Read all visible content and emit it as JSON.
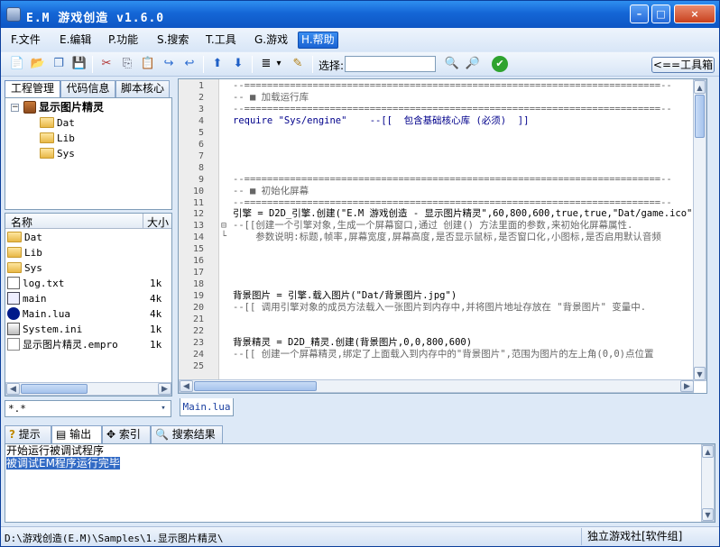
{
  "window": {
    "title": "E.M 游戏创造 v1.6.0",
    "buttons": {
      "minimize": "–",
      "maximize": "□",
      "close": "×"
    }
  },
  "menu": {
    "items": [
      {
        "label": "F.文件"
      },
      {
        "label": "E.编辑"
      },
      {
        "label": "P.功能"
      },
      {
        "label": "S.搜索"
      },
      {
        "label": "T.工具"
      },
      {
        "label": "G.游戏"
      },
      {
        "label": "H.帮助"
      }
    ]
  },
  "toolbar": {
    "icons": {
      "new": "📄",
      "open": "📂",
      "copy_window": "❐",
      "save": "💾",
      "cut": "✂",
      "copy": "⎘",
      "paste": "📋",
      "redo": "↪",
      "undo": "↩",
      "up": "⬆",
      "down": "⬇",
      "list": "≣",
      "dropdown": "▾",
      "comment": "✎",
      "find": "🔍",
      "find_next": "🔎",
      "ok": "✔"
    },
    "select_label": "选择:",
    "select_value": "",
    "toolbox_button": "<==工具箱"
  },
  "project_panel": {
    "tabs": [
      "工程管理",
      "代码信息",
      "脚本核心"
    ],
    "tree": {
      "root": "显示图片精灵",
      "expander": "−",
      "children": [
        "Dat",
        "Lib",
        "Sys"
      ]
    },
    "files": {
      "col_name": "名称",
      "col_size": "大小",
      "rows": [
        {
          "name": "Dat",
          "size": "",
          "icon": "folder"
        },
        {
          "name": "Lib",
          "size": "",
          "icon": "folder"
        },
        {
          "name": "Sys",
          "size": "",
          "icon": "folder"
        },
        {
          "name": "log.txt",
          "size": "1k",
          "icon": "text-file"
        },
        {
          "name": "main",
          "size": "4k",
          "icon": "script-file"
        },
        {
          "name": "Main.lua",
          "size": "4k",
          "icon": "lua-file"
        },
        {
          "name": "System.ini",
          "size": "1k",
          "icon": "ini-file"
        },
        {
          "name": "显示图片精灵.empro",
          "size": "1k",
          "icon": "project-file"
        }
      ]
    },
    "filter": "*.*",
    "scroll": {
      "left": "◀",
      "right": "▶",
      "down": "▾"
    }
  },
  "editor": {
    "file_tab": "Main.lua",
    "fold_markers": {
      "open": "⊟",
      "end": "└"
    },
    "scroll": {
      "up": "▲",
      "down": "▼",
      "left": "◀",
      "right": "▶"
    },
    "lines": [
      {
        "n": "1",
        "text": "--=========================================================================--",
        "cls": "c-cmt"
      },
      {
        "n": "2",
        "text": "-- ■ 加载运行库",
        "cls": "c-cmt"
      },
      {
        "n": "3",
        "text": "--=========================================================================--",
        "cls": "c-cmt"
      },
      {
        "n": "4",
        "text": "require \"Sys/engine\"    --[[  包含基础核心库 (必须)  ]]",
        "cls": "c-kw"
      },
      {
        "n": "5",
        "text": "",
        "cls": ""
      },
      {
        "n": "6",
        "text": "",
        "cls": ""
      },
      {
        "n": "7",
        "text": "",
        "cls": ""
      },
      {
        "n": "8",
        "text": "",
        "cls": ""
      },
      {
        "n": "9",
        "text": "--=========================================================================--",
        "cls": "c-cmt"
      },
      {
        "n": "10",
        "text": "-- ■ 初始化屏幕",
        "cls": "c-cmt"
      },
      {
        "n": "11",
        "text": "--=========================================================================--",
        "cls": "c-cmt"
      },
      {
        "n": "12",
        "text": "引擎 = D2D_引擎.创建(\"E.M 游戏创造 - 显示图片精灵\",60,800,600,true,true,\"Dat/game.ico\")",
        "cls": ""
      },
      {
        "n": "13",
        "text": "--[[创建一个引擎对象,生成一个屏幕窗口,通过 创建() 方法里面的参数,来初始化屏幕属性.",
        "cls": "c-cmt"
      },
      {
        "n": "14",
        "text": "    参数说明:标题,帧率,屏幕宽度,屏幕高度,是否显示鼠标,是否窗口化,小图标,是否启用默认音频",
        "cls": "c-cmt"
      },
      {
        "n": "15",
        "text": "",
        "cls": ""
      },
      {
        "n": "16",
        "text": "",
        "cls": ""
      },
      {
        "n": "17",
        "text": "",
        "cls": ""
      },
      {
        "n": "18",
        "text": "",
        "cls": ""
      },
      {
        "n": "19",
        "text": "背景图片 = 引擎.载入图片(\"Dat/背景图片.jpg\")",
        "cls": ""
      },
      {
        "n": "20",
        "text": "--[[ 调用引擎对象的成员方法载入一张图片到内存中,并将图片地址存放在 \"背景图片\" 变量中.",
        "cls": "c-cmt"
      },
      {
        "n": "21",
        "text": "",
        "cls": ""
      },
      {
        "n": "22",
        "text": "",
        "cls": ""
      },
      {
        "n": "23",
        "text": "背景精灵 = D2D_精灵.创建(背景图片,0,0,800,600)",
        "cls": ""
      },
      {
        "n": "24",
        "text": "--[[ 创建一个屏幕精灵,绑定了上面载入到内存中的\"背景图片\",范围为图片的左上角(0,0)点位置",
        "cls": "c-cmt"
      },
      {
        "n": "25",
        "text": "",
        "cls": ""
      }
    ]
  },
  "bottom_panel": {
    "tabs": [
      {
        "label": "提示",
        "icon": "?"
      },
      {
        "label": "输出",
        "icon": "▤"
      },
      {
        "label": "索引",
        "icon": "✥"
      },
      {
        "label": "搜索结果",
        "icon": "🔍"
      }
    ],
    "output": [
      "开始运行被调试程序",
      "被调试EM程序运行完毕"
    ]
  },
  "status": {
    "path": "D:\\游戏创造(E.M)\\Samples\\1.显示图片精灵\\",
    "right": "独立游戏社[软件组]"
  }
}
